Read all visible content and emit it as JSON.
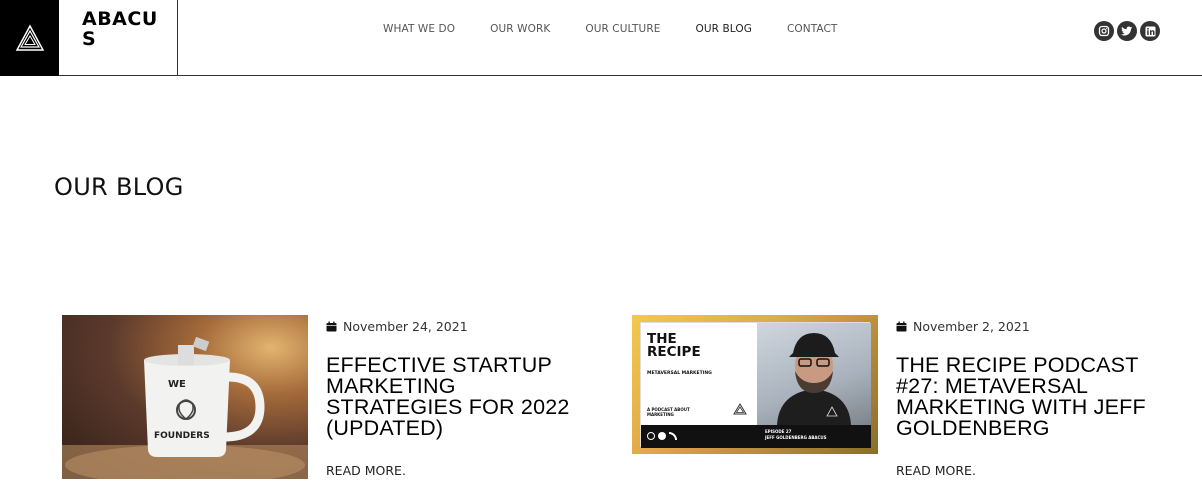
{
  "brand": {
    "name": "ABACUS",
    "logo_icon": "triangle-logo-icon"
  },
  "nav": {
    "items": [
      {
        "label": "WHAT WE DO",
        "active": false
      },
      {
        "label": "OUR WORK",
        "active": false
      },
      {
        "label": "OUR CULTURE",
        "active": false
      },
      {
        "label": "OUR BLOG",
        "active": true
      },
      {
        "label": "CONTACT",
        "active": false
      }
    ]
  },
  "social": [
    "instagram-icon",
    "twitter-icon",
    "linkedin-icon"
  ],
  "page": {
    "title": "OUR BLOG"
  },
  "posts": [
    {
      "date": "November 24, 2021",
      "title": "EFFECTIVE STARTUP MARKETING STRATEGIES FOR 2022 (UPDATED)",
      "read_more": "READ MORE.",
      "image": {
        "mug_top": "WE",
        "mug_bottom": "FOUNDERS"
      }
    },
    {
      "date": "November 2, 2021",
      "title": "THE RECIPE PODCAST #27: METAVERSAL MARKETING WITH JEFF GOLDENBERG",
      "read_more": "READ MORE.",
      "image": {
        "heading": "THE RECIPE",
        "subheading": "METAVERSAL MARKETING",
        "tagline": "A PODCAST ABOUT MARKETING",
        "episode": "EPISODE 27",
        "guest": "JEFF GOLDENBERG ABACUS"
      }
    }
  ],
  "colors": {
    "header_border": "#333333",
    "logo_bg": "#000000",
    "social_bg": "#333333",
    "nav_text": "#555555"
  }
}
